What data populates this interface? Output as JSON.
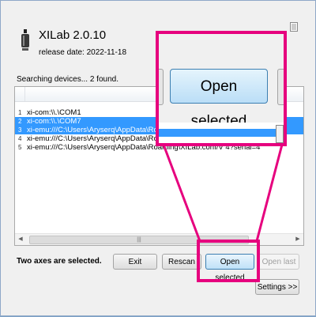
{
  "app": {
    "title": "XILab 2.0.10",
    "release": "release date: 2022-11-18"
  },
  "status": "Searching devices... 2 found.",
  "devices": [
    {
      "num": "1",
      "text": "xi-com:\\\\.\\COM1",
      "selected": false
    },
    {
      "num": "2",
      "text": "xi-com:\\\\.\\COM7",
      "selected": true
    },
    {
      "num": "3",
      "text": "xi-emu:///C:\\Users\\Aryserq\\AppData\\Roaming\\XILab.conf/V 1?serial=2",
      "selected": true
    },
    {
      "num": "4",
      "text": "xi-emu:///C:\\Users\\Aryserq\\AppData\\Roaming\\XILab.conf/V 2?serial=3",
      "selected": false
    },
    {
      "num": "5",
      "text": "xi-emu:///C:\\Users\\Aryserq\\AppData\\Roaming\\XILab.conf/V 4?serial=4",
      "selected": false
    }
  ],
  "scroll": {
    "left": "◀",
    "right": "▶",
    "grip": "|||"
  },
  "axes_message": "Two axes are selected.",
  "buttons": {
    "exit": "Exit",
    "rescan": "Rescan",
    "open_selected": "Open selected",
    "open_last": "Open last",
    "settings": "Settings >>"
  },
  "zoom": {
    "label": "Open selected"
  },
  "colors": {
    "selection": "#3399ff",
    "highlight_box": "#e6007e",
    "button_hover": "#bfe1f8"
  }
}
